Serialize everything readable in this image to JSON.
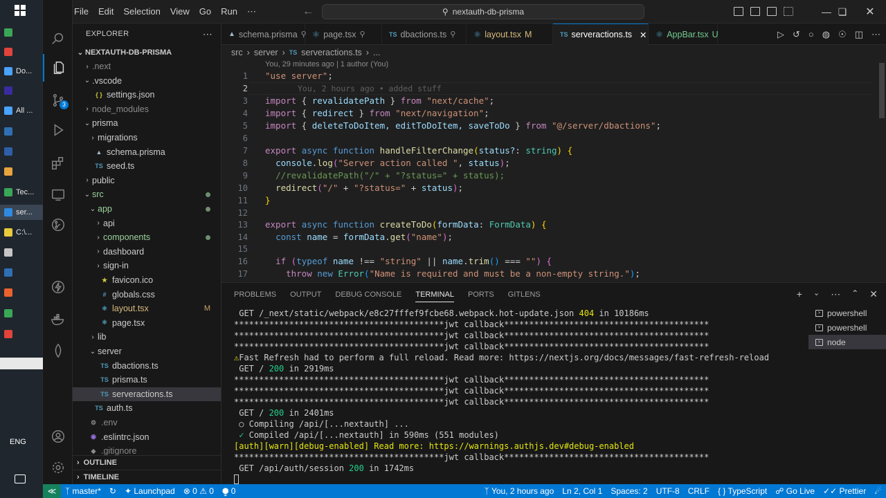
{
  "window": {
    "title": "nextauth-db-prisma"
  },
  "menu": [
    "File",
    "Edit",
    "Selection",
    "View",
    "Go",
    "Run",
    "⋯"
  ],
  "taskbar": [
    {
      "label": "",
      "color": "#3aa757",
      "icon": "excel-icon"
    },
    {
      "label": "",
      "color": "#e0443a",
      "icon": "app-red-icon"
    },
    {
      "label": "Do...",
      "color": "#4aa3ff",
      "icon": "download-icon"
    },
    {
      "label": "",
      "color": "#3b2b9e",
      "icon": "after-effects-icon"
    },
    {
      "label": "All ...",
      "color": "#4aa3ff",
      "icon": "window-icon"
    },
    {
      "label": "",
      "color": "#2f6fb4",
      "icon": "lightroom-icon"
    },
    {
      "label": "",
      "color": "#2c5fa8",
      "icon": "photoshop-icon"
    },
    {
      "label": "",
      "color": "#e8a33d",
      "icon": "git-icon"
    },
    {
      "label": "Tec...",
      "color": "#3aa757",
      "icon": "app-green-icon"
    },
    {
      "label": "ser...",
      "color": "#2f8ae0",
      "icon": "vscode-icon"
    },
    {
      "label": "C:\\...",
      "color": "#e8c93d",
      "icon": "folder-icon"
    },
    {
      "label": "",
      "color": "#c5c5c5",
      "icon": "notepad-icon"
    },
    {
      "label": "",
      "color": "#2f6fb4",
      "icon": "powershell-icon"
    },
    {
      "label": "",
      "color": "#e8622f",
      "icon": "app-orange-icon"
    },
    {
      "label": "",
      "color": "#3aa757",
      "icon": "app-green2-icon"
    },
    {
      "label": "",
      "color": "#e0443a",
      "icon": "app-red2-icon"
    }
  ],
  "tray": {
    "lang": "ENG"
  },
  "explorer": {
    "title": "EXPLORER",
    "root": "NEXTAUTH-DB-PRISMA",
    "items": [
      {
        "label": ".next",
        "depth": 0,
        "type": "folder",
        "open": false,
        "color": "#8a8a8a"
      },
      {
        "label": ".vscode",
        "depth": 0,
        "type": "folder",
        "open": true,
        "color": "#cccccc"
      },
      {
        "label": "settings.json",
        "depth": 1,
        "type": "json",
        "color": "#cccccc"
      },
      {
        "label": "node_modules",
        "depth": 0,
        "type": "folder",
        "open": false,
        "color": "#8a8a8a"
      },
      {
        "label": "prisma",
        "depth": 0,
        "type": "folder",
        "open": true,
        "color": "#cccccc"
      },
      {
        "label": "migrations",
        "depth": 1,
        "type": "folder",
        "open": false,
        "color": "#cccccc"
      },
      {
        "label": "schema.prisma",
        "depth": 1,
        "type": "prisma",
        "color": "#cccccc"
      },
      {
        "label": "seed.ts",
        "depth": 1,
        "type": "ts",
        "color": "#cccccc"
      },
      {
        "label": "public",
        "depth": 0,
        "type": "folder",
        "open": false,
        "color": "#cccccc"
      },
      {
        "label": "src",
        "depth": 0,
        "type": "folder",
        "open": true,
        "color": "#9cd29c",
        "dot": true
      },
      {
        "label": "app",
        "depth": 1,
        "type": "folder",
        "open": true,
        "color": "#9cd29c",
        "dot": true
      },
      {
        "label": "api",
        "depth": 2,
        "type": "folder",
        "open": false,
        "color": "#cccccc"
      },
      {
        "label": "components",
        "depth": 2,
        "type": "folder",
        "open": false,
        "color": "#9cd29c",
        "dot": true
      },
      {
        "label": "dashboard",
        "depth": 2,
        "type": "folder",
        "open": false,
        "color": "#cccccc"
      },
      {
        "label": "sign-in",
        "depth": 2,
        "type": "folder",
        "open": false,
        "color": "#cccccc"
      },
      {
        "label": "favicon.ico",
        "depth": 2,
        "type": "ico",
        "color": "#cccccc"
      },
      {
        "label": "globals.css",
        "depth": 2,
        "type": "css",
        "color": "#cccccc"
      },
      {
        "label": "layout.tsx",
        "depth": 2,
        "type": "tsx",
        "color": "#d7ba7d",
        "tag": "M"
      },
      {
        "label": "page.tsx",
        "depth": 2,
        "type": "tsx",
        "color": "#cccccc"
      },
      {
        "label": "lib",
        "depth": 1,
        "type": "folder",
        "open": false,
        "color": "#cccccc"
      },
      {
        "label": "server",
        "depth": 1,
        "type": "folder",
        "open": true,
        "color": "#cccccc"
      },
      {
        "label": "dbactions.ts",
        "depth": 2,
        "type": "ts",
        "color": "#cccccc"
      },
      {
        "label": "prisma.ts",
        "depth": 2,
        "type": "ts",
        "color": "#cccccc"
      },
      {
        "label": "serveractions.ts",
        "depth": 2,
        "type": "ts",
        "color": "#cccccc",
        "selected": true
      },
      {
        "label": "auth.ts",
        "depth": 1,
        "type": "ts",
        "color": "#cccccc"
      },
      {
        "label": ".env",
        "depth": 0,
        "type": "env",
        "color": "#8a8a8a"
      },
      {
        "label": ".eslintrc.json",
        "depth": 0,
        "type": "eslint",
        "color": "#cccccc"
      },
      {
        "label": ".gitignore",
        "depth": 0,
        "type": "git",
        "color": "#8a8a8a"
      }
    ],
    "outline": "OUTLINE",
    "timeline": "TIMELINE"
  },
  "scm_badge": "3",
  "tabs": [
    {
      "label": "schema.prisma",
      "icon": "prisma",
      "color": "#9d9d9d",
      "pin": true
    },
    {
      "label": "page.tsx",
      "icon": "react",
      "color": "#9d9d9d",
      "pin": true
    },
    {
      "label": "dbactions.ts",
      "icon": "TS",
      "color": "#9d9d9d",
      "pin": true
    },
    {
      "label": "layout.tsx",
      "icon": "react",
      "color": "#d7ba7d",
      "tag": "M"
    },
    {
      "label": "serveractions.ts",
      "icon": "TS",
      "color": "#ffffff",
      "active": true
    },
    {
      "label": "AppBar.tsx",
      "icon": "react",
      "color": "#73c991",
      "tag": "U"
    }
  ],
  "breadcrumbs": [
    "src",
    "server",
    "serveractions.ts",
    "..."
  ],
  "blame": "You, 29 minutes ago | 1 author (You)",
  "inline_blame": "You, 2 hours ago • added stuff",
  "code": [
    {
      "n": "1"
    },
    {
      "n": "2"
    },
    {
      "n": "3"
    },
    {
      "n": "4"
    },
    {
      "n": "5"
    },
    {
      "n": "6"
    },
    {
      "n": "7"
    },
    {
      "n": "8"
    },
    {
      "n": "9"
    },
    {
      "n": "10"
    },
    {
      "n": "11"
    },
    {
      "n": "12"
    },
    {
      "n": "13"
    },
    {
      "n": "14"
    },
    {
      "n": "15"
    },
    {
      "n": "16"
    },
    {
      "n": "17"
    }
  ],
  "code_text": {
    "l1a": "\"use server\"",
    "l1b": ";",
    "l3a": "import",
    "l3b": " { ",
    "l3c": "revalidatePath",
    "l3d": " } ",
    "l3e": "from",
    "l3f": " ",
    "l3g": "\"next/cache\"",
    "l3h": ";",
    "l4a": "import",
    "l4c": "redirect",
    "l4e": "from",
    "l4g": "\"next/navigation\"",
    "l5a": "import",
    "l5c": "deleteToDoItem, editToDoItem, saveToDo",
    "l5e": "from",
    "l5g": "\"@/server/dbactions\"",
    "l7a": "export",
    "l7b": "async",
    "l7c": "function",
    "l7d": "handleFilterChange",
    "l7e": "status?",
    "l7f": "string",
    "l8a": "console",
    "l8b": "log",
    "l8c": "\"Server action called \"",
    "l8d": "status",
    "l9": "//revalidatePath(\"/\" + \"?status=\" + status);",
    "l10a": "redirect",
    "l10b": "\"/\"",
    "l10c": "\"?status=\"",
    "l10d": "status",
    "l13a": "export",
    "l13b": "async",
    "l13c": "function",
    "l13d": "createToDo",
    "l13e": "formData",
    "l13f": "FormData",
    "l14a": "const",
    "l14b": "name",
    "l14c": "formData",
    "l14d": "get",
    "l14e": "\"name\"",
    "l16a": "if",
    "l16b": "typeof",
    "l16c": "name",
    "l16d": "\"string\"",
    "l16e": "name",
    "l16f": "trim",
    "l16g": "\"\"",
    "l17a": "throw",
    "l17b": "new",
    "l17c": "Error",
    "l17d": "\"Name is required and must be a non-empty string.\""
  },
  "panel": {
    "tabs": [
      "PROBLEMS",
      "OUTPUT",
      "DEBUG CONSOLE",
      "TERMINAL",
      "PORTS",
      "GITLENS"
    ],
    "active_tab": "TERMINAL",
    "shells": [
      "powershell",
      "powershell",
      "node"
    ]
  },
  "terminal": {
    "l1a": " GET /_next/static/webpack/e8c27fffef9fcbe68.webpack.hot-update.json ",
    "l1b": "404",
    "l1c": " in 10186ms",
    "stars_a": "******************************************",
    "jwt": "jwt callback",
    "stars_b": "*****************************************",
    "l5a": "⚠",
    "l5b": "Fast Refresh had to perform a full reload. Read more: https://nextjs.org/docs/messages/fast-refresh-reload",
    "l6a": " GET / ",
    "l6b": "200",
    "l6c": " in 2919ms",
    "l10a": " GET / ",
    "l10b": "200",
    "l10c": " in 2401ms",
    "l11": " ○ Compiling /api/[...nextauth] ...",
    "l12a": " ✓",
    "l12b": " Compiled /api/[...nextauth] in 590ms (551 modules)",
    "l13": "[auth][warn][debug-enabled] Read more: https://warnings.authjs.dev#debug-enabled",
    "l15a": " GET /api/auth/session ",
    "l15b": "200",
    "l15c": " in 1742ms"
  },
  "status": {
    "branch": "master*",
    "launchpad": "Launchpad",
    "errors": "0",
    "warnings": "0",
    "ports": "0",
    "blame": "You, 2 hours ago",
    "position": "Ln 2, Col 1",
    "spaces": "Spaces: 2",
    "encoding": "UTF-8",
    "eol": "CRLF",
    "language": "TypeScript",
    "golive": "Go Live",
    "prettier": "Prettier"
  }
}
